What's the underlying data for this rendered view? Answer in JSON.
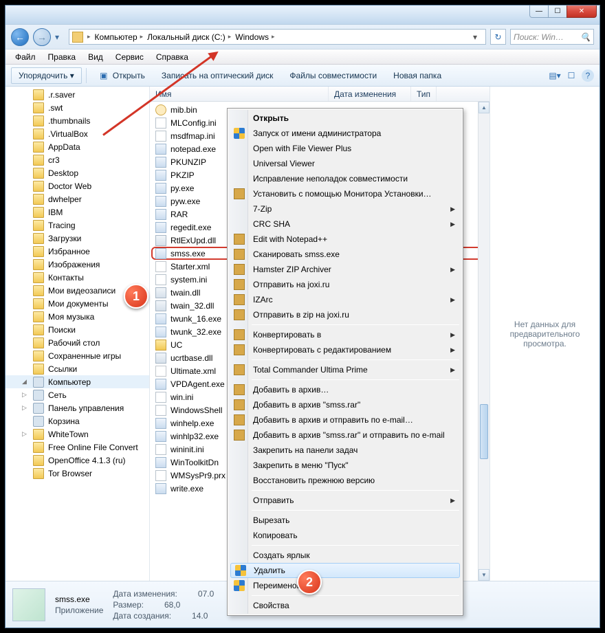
{
  "window": {
    "min_glyph": "—",
    "max_glyph": "☐",
    "close_glyph": "✕"
  },
  "address": {
    "back_glyph": "←",
    "fwd_glyph": "→",
    "drop_glyph": "▾",
    "refresh_glyph": "↻",
    "crumbs": [
      "Компьютер",
      "Локальный диск (C:)",
      "Windows"
    ],
    "crumb_sep": "▸",
    "addr_more": "▾",
    "search_placeholder": "Поиск: Win…",
    "search_glyph": "🔍"
  },
  "menubar": [
    "Файл",
    "Правка",
    "Вид",
    "Сервис",
    "Справка"
  ],
  "toolbar": {
    "organize": "Упорядочить ▾",
    "open": "Открыть",
    "burn": "Записать на оптический диск",
    "compat": "Файлы совместимости",
    "newfolder": "Новая папка",
    "views_glyph": "▤▾",
    "preview_glyph": "☐",
    "help_glyph": "?"
  },
  "columns": {
    "name": "Имя",
    "date": "Дата изменения",
    "type": "Тип"
  },
  "sidebar": {
    "items": [
      {
        "label": ".r.saver",
        "icon": "folder"
      },
      {
        "label": ".swt",
        "icon": "folder"
      },
      {
        "label": ".thumbnails",
        "icon": "folder"
      },
      {
        "label": ".VirtualBox",
        "icon": "folder"
      },
      {
        "label": "AppData",
        "icon": "folder"
      },
      {
        "label": "cr3",
        "icon": "folder"
      },
      {
        "label": "Desktop",
        "icon": "folder"
      },
      {
        "label": "Doctor Web",
        "icon": "folder"
      },
      {
        "label": "dwhelper",
        "icon": "folder"
      },
      {
        "label": "IBM",
        "icon": "folder"
      },
      {
        "label": "Tracing",
        "icon": "folder"
      },
      {
        "label": "Загрузки",
        "icon": "folder"
      },
      {
        "label": "Избранное",
        "icon": "folder"
      },
      {
        "label": "Изображения",
        "icon": "folder"
      },
      {
        "label": "Контакты",
        "icon": "folder"
      },
      {
        "label": "Мои видеозаписи",
        "icon": "folder"
      },
      {
        "label": "Мои документы",
        "icon": "folder"
      },
      {
        "label": "Моя музыка",
        "icon": "folder"
      },
      {
        "label": "Поиски",
        "icon": "folder"
      },
      {
        "label": "Рабочий стол",
        "icon": "folder"
      },
      {
        "label": "Сохраненные игры",
        "icon": "folder"
      },
      {
        "label": "Ссылки",
        "icon": "folder"
      },
      {
        "label": "Компьютер",
        "icon": "sys",
        "selected": true,
        "expand": "◢"
      },
      {
        "label": "Сеть",
        "icon": "sys",
        "expand": "▷"
      },
      {
        "label": "Панель управления",
        "icon": "sys",
        "expand": "▷"
      },
      {
        "label": "Корзина",
        "icon": "sys"
      },
      {
        "label": "WhiteTown",
        "icon": "folder",
        "expand": "▷"
      },
      {
        "label": "Free Online File Convert",
        "icon": "folder"
      },
      {
        "label": "OpenOffice 4.1.3 (ru)",
        "icon": "folder"
      },
      {
        "label": "Tor Browser",
        "icon": "folder"
      }
    ]
  },
  "files": [
    {
      "name": "mib.bin",
      "icon": "bin"
    },
    {
      "name": "MLConfig.ini",
      "icon": "ini"
    },
    {
      "name": "msdfmap.ini",
      "icon": "ini"
    },
    {
      "name": "notepad.exe",
      "icon": "exe"
    },
    {
      "name": "PKUNZIP",
      "icon": "exe"
    },
    {
      "name": "PKZIP",
      "icon": "exe"
    },
    {
      "name": "py.exe",
      "icon": "exe"
    },
    {
      "name": "pyw.exe",
      "icon": "exe"
    },
    {
      "name": "RAR",
      "icon": "exe"
    },
    {
      "name": "regedit.exe",
      "icon": "exe"
    },
    {
      "name": "RtlExUpd.dll",
      "icon": "dll"
    },
    {
      "name": "smss.exe",
      "icon": "exe",
      "selected": true
    },
    {
      "name": "Starter.xml",
      "icon": "xml"
    },
    {
      "name": "system.ini",
      "icon": "ini"
    },
    {
      "name": "twain.dll",
      "icon": "dll"
    },
    {
      "name": "twain_32.dll",
      "icon": "dll"
    },
    {
      "name": "twunk_16.exe",
      "icon": "exe"
    },
    {
      "name": "twunk_32.exe",
      "icon": "exe"
    },
    {
      "name": "UC",
      "icon": "fold"
    },
    {
      "name": "ucrtbase.dll",
      "icon": "dll"
    },
    {
      "name": "Ultimate.xml",
      "icon": "xml"
    },
    {
      "name": "VPDAgent.exe",
      "icon": "exe"
    },
    {
      "name": "win.ini",
      "icon": "ini"
    },
    {
      "name": "WindowsShell",
      "icon": "ini"
    },
    {
      "name": "winhelp.exe",
      "icon": "exe"
    },
    {
      "name": "winhlp32.exe",
      "icon": "exe"
    },
    {
      "name": "wininit.ini",
      "icon": "ini"
    },
    {
      "name": "WinToolkitDn",
      "icon": "exe"
    },
    {
      "name": "WMSysPr9.prx",
      "icon": "ini"
    },
    {
      "name": "write.exe",
      "icon": "exe"
    }
  ],
  "preview": {
    "text": "Нет данных для предварительного просмотра."
  },
  "statusbar": {
    "filename": "smss.exe",
    "type": "Приложение",
    "date_label": "Дата изменения:",
    "date_value": "07.0",
    "size_label": "Размер:",
    "size_value": "68,0",
    "created_label": "Дата создания:",
    "created_value": "14.0"
  },
  "context_menu": [
    {
      "label": "Открыть",
      "bold": true
    },
    {
      "label": "Запуск от имени администратора",
      "icon": "shield"
    },
    {
      "label": "Open with File Viewer Plus"
    },
    {
      "label": "Universal Viewer"
    },
    {
      "label": "Исправление неполадок совместимости"
    },
    {
      "label": "Установить с помощью Монитора Установки…",
      "icon": "mi"
    },
    {
      "label": "7-Zip",
      "submenu": true
    },
    {
      "label": "CRC SHA",
      "submenu": true
    },
    {
      "label": "Edit with Notepad++",
      "icon": "mi"
    },
    {
      "label": "Сканировать smss.exe",
      "icon": "mi"
    },
    {
      "label": "Hamster ZIP Archiver",
      "icon": "mi",
      "submenu": true
    },
    {
      "label": "Отправить на joxi.ru",
      "icon": "mi"
    },
    {
      "label": "IZArc",
      "icon": "mi",
      "submenu": true
    },
    {
      "label": "Отправить в zip на joxi.ru",
      "icon": "mi"
    },
    {
      "sep": true
    },
    {
      "label": "Конвертировать в",
      "icon": "mi",
      "submenu": true
    },
    {
      "label": "Конвертировать с редактированием",
      "icon": "mi",
      "submenu": true
    },
    {
      "sep": true
    },
    {
      "label": "Total Commander Ultima Prime",
      "icon": "mi",
      "submenu": true
    },
    {
      "sep": true
    },
    {
      "label": "Добавить в архив…",
      "icon": "mi"
    },
    {
      "label": "Добавить в архив \"smss.rar\"",
      "icon": "mi"
    },
    {
      "label": "Добавить в архив и отправить по e-mail…",
      "icon": "mi"
    },
    {
      "label": "Добавить в архив \"smss.rar\" и отправить по e-mail",
      "icon": "mi"
    },
    {
      "label": "Закрепить на панели задач"
    },
    {
      "label": "Закрепить в меню \"Пуск\""
    },
    {
      "label": "Восстановить прежнюю версию"
    },
    {
      "sep": true
    },
    {
      "label": "Отправить",
      "submenu": true
    },
    {
      "sep": true
    },
    {
      "label": "Вырезать"
    },
    {
      "label": "Копировать"
    },
    {
      "sep": true
    },
    {
      "label": "Создать ярлык"
    },
    {
      "label": "Удалить",
      "icon": "shield",
      "hover": true
    },
    {
      "label": "Переименовать",
      "icon": "shield"
    },
    {
      "sep": true
    },
    {
      "label": "Свойства"
    }
  ],
  "callouts": {
    "one": "1",
    "two": "2"
  }
}
